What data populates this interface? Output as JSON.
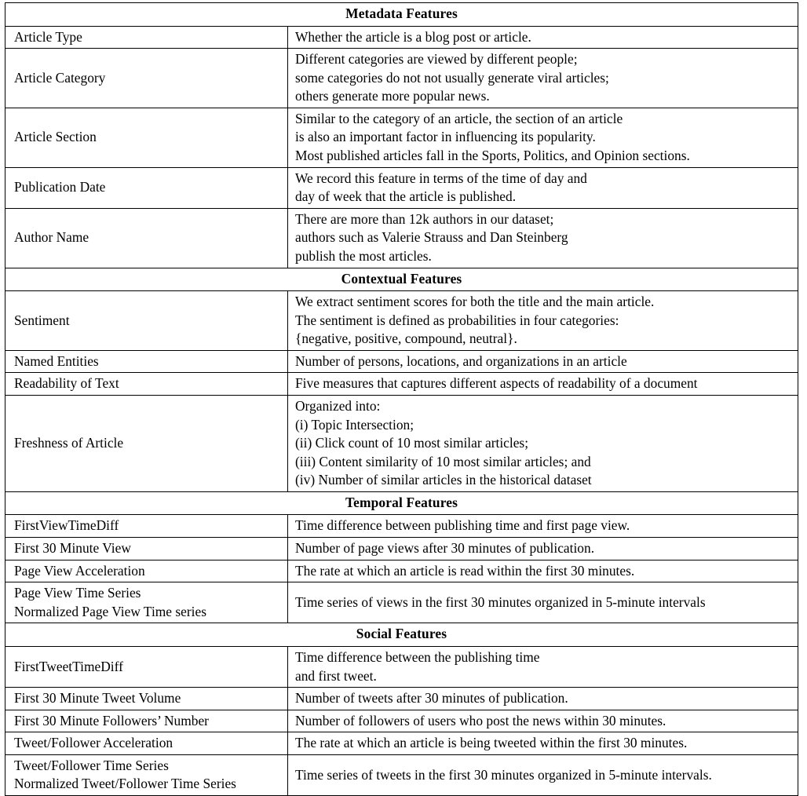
{
  "table": {
    "caption_rows": [
      {
        "kind": "section",
        "label": "Metadata Features"
      },
      {
        "kind": "row",
        "name": "Article Type",
        "desc": "Whether the article is a blog post or article."
      },
      {
        "kind": "row",
        "name": "Article Category",
        "desc": "Different categories are viewed by different people;\nsome categories do not not usually generate viral articles;\nothers generate more popular news."
      },
      {
        "kind": "row",
        "name": "Article Section",
        "desc": "Similar to the category of an article, the section of an article\nis also an important factor in influencing its popularity.\nMost published articles fall in the Sports, Politics, and Opinion sections."
      },
      {
        "kind": "row",
        "name": "Publication Date",
        "desc": "We record this feature in terms of the time of day and\nday of week that the article is published."
      },
      {
        "kind": "row",
        "name": "Author Name",
        "desc": "There are more than 12k authors in our dataset;\nauthors such as Valerie Strauss and Dan Steinberg\npublish the most articles."
      },
      {
        "kind": "section",
        "label": "Contextual Features"
      },
      {
        "kind": "row",
        "name": "Sentiment",
        "desc": "We extract sentiment scores for both the title and the main article.\nThe sentiment is defined as probabilities in four categories:\n{negative, positive, compound, neutral}."
      },
      {
        "kind": "row",
        "name": "Named Entities",
        "desc": "Number of persons, locations, and organizations in an article"
      },
      {
        "kind": "row",
        "name": "Readability of Text",
        "desc": "Five measures that captures different aspects of readability of a document"
      },
      {
        "kind": "row",
        "name": "Freshness of Article",
        "desc": "Organized into:\n(i) Topic Intersection;\n(ii) Click count of 10 most similar articles;\n(iii) Content similarity of 10 most similar articles; and\n(iv) Number of similar articles in the historical dataset"
      },
      {
        "kind": "section",
        "label": "Temporal Features"
      },
      {
        "kind": "row",
        "name": "FirstViewTimeDiff",
        "desc": "Time difference between publishing time and first page view."
      },
      {
        "kind": "row",
        "name": "First 30 Minute View",
        "desc": "Number of page views after 30 minutes of publication."
      },
      {
        "kind": "row",
        "name": "Page View Acceleration",
        "desc": "The rate at which an article is read within the first 30 minutes."
      },
      {
        "kind": "row",
        "name": "Page View Time Series\nNormalized Page View Time series",
        "desc": "Time series of views in the first 30 minutes organized in 5-minute intervals"
      },
      {
        "kind": "section",
        "label": "Social Features"
      },
      {
        "kind": "row",
        "name": "FirstTweetTimeDiff",
        "desc": "Time difference between the publishing time\nand first tweet."
      },
      {
        "kind": "row",
        "name": "First 30 Minute Tweet Volume",
        "desc": "Number of tweets after 30 minutes of publication."
      },
      {
        "kind": "row",
        "name": "First 30 Minute Followers’ Number",
        "desc": "Number of followers of users who post the news within 30 minutes."
      },
      {
        "kind": "row",
        "name": "Tweet/Follower Acceleration",
        "desc": "The rate at which an article is being tweeted within the first 30 minutes."
      },
      {
        "kind": "row",
        "name": "Tweet/Follower Time Series\nNormalized Tweet/Follower Time Series",
        "desc": "Time series of tweets in the first 30 minutes organized in 5-minute intervals."
      }
    ]
  }
}
